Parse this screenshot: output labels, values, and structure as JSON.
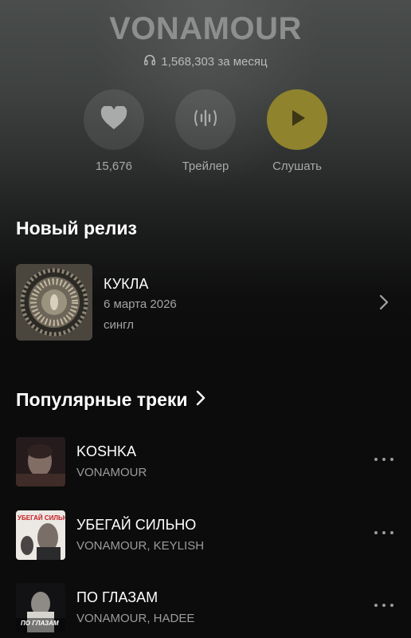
{
  "artist": {
    "name": "VONAMOUR",
    "listeners": "1,568,303 за месяц"
  },
  "actions": {
    "like_count": "15,676",
    "trailer_label": "Трейлер",
    "listen_label": "Слушать"
  },
  "colors": {
    "play_accent": "#8f832d",
    "text_primary": "#ffffff",
    "text_secondary": "#a3a5a4",
    "background": "#0c0c0c"
  },
  "new_release": {
    "section_title": "Новый релиз",
    "title": "КУКЛА",
    "date": "6 марта 2026",
    "type": "сингл"
  },
  "popular": {
    "section_title": "Популярные треки",
    "tracks": [
      {
        "title": "KOSHKA",
        "artists": "VONAMOUR",
        "cover_text": ""
      },
      {
        "title": "УБЕГАЙ СИЛЬНО",
        "artists": "VONAMOUR, KEYLISH",
        "cover_text": "УБЕГАЙ СИЛЬНО"
      },
      {
        "title": "ПО ГЛАЗАМ",
        "artists": "VONAMOUR, HADEE",
        "cover_text": "ПО ГЛАЗАМ"
      }
    ]
  },
  "icons": {
    "listeners": "headphones-icon",
    "like": "heart-icon",
    "trailer": "waveform-icon",
    "listen": "play-icon",
    "release_open": "chevron-right-icon",
    "popular_open": "chevron-right-icon",
    "track_menu": "more-dots-icon"
  }
}
